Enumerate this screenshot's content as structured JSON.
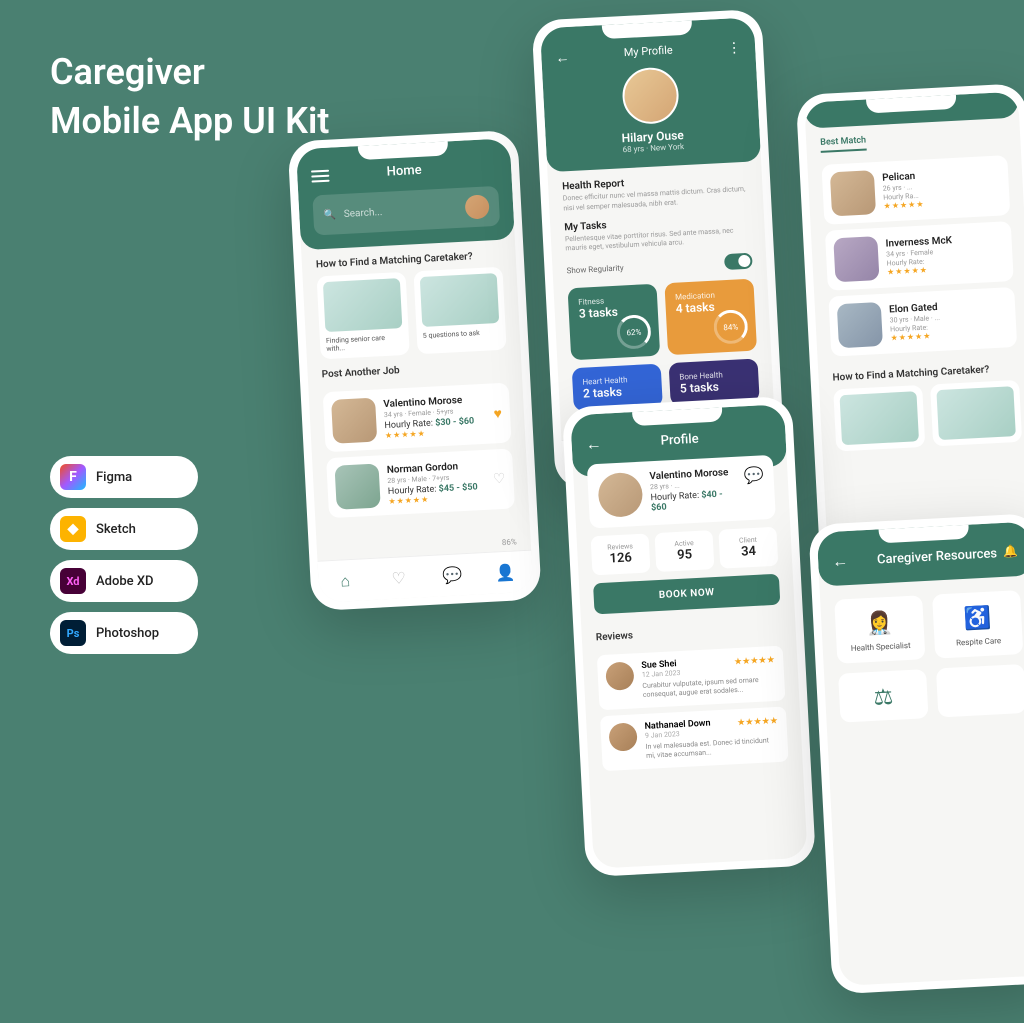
{
  "title_line1": "Caregiver",
  "title_line2": "Mobile App UI Kit",
  "tools": [
    {
      "label": "Figma",
      "bg": "#fff",
      "color": "#f24e1e",
      "mark": "F"
    },
    {
      "label": "Sketch",
      "bg": "#fdb300",
      "color": "#fff",
      "mark": "◆"
    },
    {
      "label": "Adobe XD",
      "bg": "#470137",
      "color": "#ff61f6",
      "mark": "Xd"
    },
    {
      "label": "Photoshop",
      "bg": "#001e36",
      "color": "#31a8ff",
      "mark": "Ps"
    }
  ],
  "home": {
    "title": "Home",
    "search_placeholder": "Search...",
    "section1": "How to Find a Matching Caretaker?",
    "card1": "Finding senior care with...",
    "card2": "5 questions to ask",
    "section2": "Post Another Job",
    "caregivers": [
      {
        "name": "Valentino Morose",
        "meta": "34 yrs · Female · 5+yrs",
        "rate_label": "Hourly Rate:",
        "rate": "$30 - $60"
      },
      {
        "name": "Norman Gordon",
        "meta": "28 yrs · Male · 7+yrs",
        "rate_label": "Hourly Rate:",
        "rate": "$45 - $50"
      }
    ],
    "pct": "86%"
  },
  "profile": {
    "title": "My Profile",
    "name": "Hilary Ouse",
    "sub": "68 yrs · New York",
    "health_title": "Health Report",
    "health_text": "Donec efficitur nunc vel massa mattis dictum. Cras dictum, nisi vel semper malesuada, nibh erat.",
    "tasks_title": "My Tasks",
    "tasks_text": "Pellentesque vitae porttitor risus. Sed ante massa, nec mauris eget, vestibulum vehicula arcu.",
    "regularity": "Show Regularity",
    "tasks": [
      {
        "label": "Fitness",
        "count": "3 tasks",
        "pct": "62%"
      },
      {
        "label": "Medication",
        "count": "4 tasks",
        "pct": "84%"
      },
      {
        "label": "Heart Health",
        "count": "2 tasks",
        "pct": ""
      },
      {
        "label": "Bone Health",
        "count": "5 tasks",
        "pct": ""
      }
    ]
  },
  "matches": {
    "tab1": "Best Match",
    "items": [
      {
        "name": "Pelican",
        "meta": "26 yrs · ...",
        "rate_label": "Hourly Ra..."
      },
      {
        "name": "Inverness McK",
        "meta": "34 yrs · Female",
        "rate_label": "Hourly Rate:"
      },
      {
        "name": "Elon Gated",
        "meta": "30 yrs · Male · ...",
        "rate_label": "Hourly Rate:"
      }
    ],
    "section": "How to Find a Matching Caretaker?"
  },
  "cg_profile": {
    "title": "Profile",
    "name": "Valentino Morose",
    "meta": "28 yrs · ...",
    "rate_label": "Hourly Rate:",
    "rate": "$40 - $60",
    "stats": [
      {
        "label": "Reviews",
        "value": "126"
      },
      {
        "label": "Active",
        "value": "95"
      },
      {
        "label": "Client",
        "value": "34"
      }
    ],
    "book": "BOOK NOW",
    "reviews_title": "Reviews",
    "reviews": [
      {
        "name": "Sue Shei",
        "date": "12 Jan 2023",
        "text": "Curabitur vulputate, ipsum sed ornare consequat, augue erat sodales..."
      },
      {
        "name": "Nathanael Down",
        "date": "9 Jan 2023",
        "text": "In vel malesuada est. Donec id tincidunt mi, vitae accumsan..."
      }
    ]
  },
  "resources": {
    "title": "Caregiver Resources",
    "items": [
      {
        "icon": "⚕",
        "label": "Health Specialist"
      },
      {
        "icon": "♿",
        "label": "Respite Care"
      },
      {
        "icon": "⚖",
        "label": ""
      },
      {
        "icon": "",
        "label": ""
      }
    ]
  }
}
